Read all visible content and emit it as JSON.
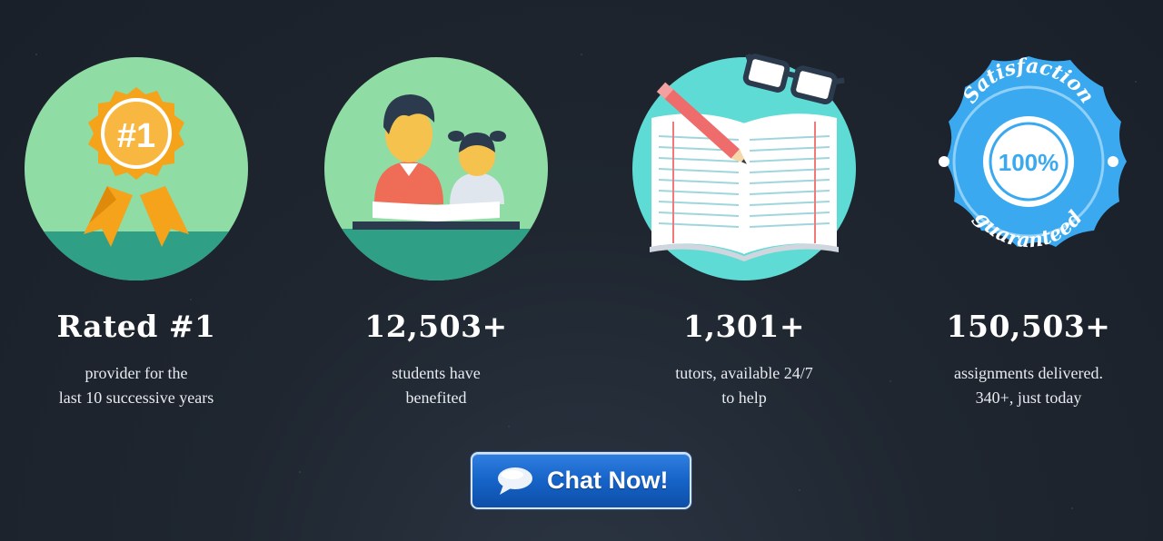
{
  "features": [
    {
      "icon": "award-ribbon-icon",
      "badge_text": "#1",
      "stat": "Rated #1",
      "desc_line1": "provider for the",
      "desc_line2": "last 10 successive years"
    },
    {
      "icon": "students-reading-icon",
      "stat": "12,503+",
      "desc_line1": "students have",
      "desc_line2": "benefited"
    },
    {
      "icon": "book-pencil-glasses-icon",
      "stat": "1,301+",
      "desc_line1": "tutors, available 24/7",
      "desc_line2": "to help"
    },
    {
      "icon": "satisfaction-guaranteed-seal-icon",
      "seal_top": "Satisfaction",
      "seal_center": "100%",
      "seal_bottom": "guaranteed",
      "stat": "150,503+",
      "desc_line1": "assignments delivered.",
      "desc_line2": "340+, just today"
    }
  ],
  "chat_button": {
    "label": "Chat Now!",
    "icon": "speech-bubble-icon"
  },
  "colors": {
    "background": "#1f2630",
    "mint": "#8fdca4",
    "teal": "#2f9f86",
    "orange": "#f5a31a",
    "aqua": "#5fdbd6",
    "seal_blue": "#3aa9f0",
    "button_blue": "#1663c8"
  }
}
